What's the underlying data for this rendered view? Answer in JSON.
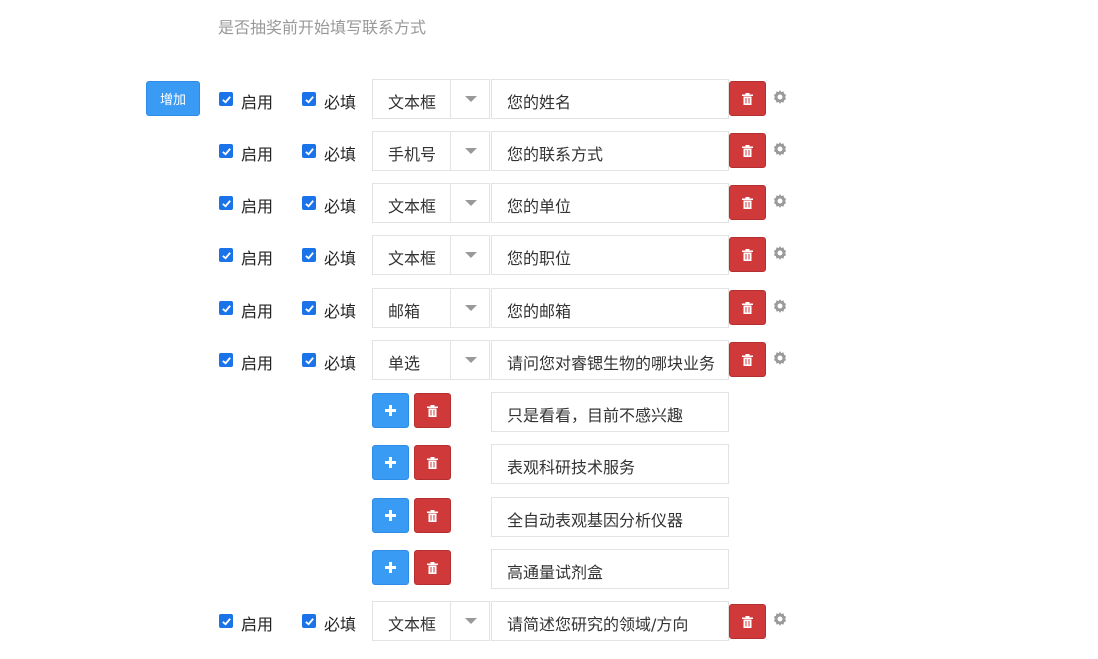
{
  "hint": "是否抽奖前开始填写联系方式",
  "add_label": "增加",
  "enable_label": "启用",
  "required_label": "必填",
  "fields": [
    {
      "type": "文本框",
      "label": "您的姓名"
    },
    {
      "type": "手机号",
      "label": "您的联系方式"
    },
    {
      "type": "文本框",
      "label": "您的单位"
    },
    {
      "type": "文本框",
      "label": "您的职位"
    },
    {
      "type": "邮箱",
      "label": "您的邮箱"
    },
    {
      "type": "单选",
      "label": "请问您对睿锶生物的哪块业务"
    }
  ],
  "options": [
    "只是看看，目前不感兴趣",
    "表观科研技术服务",
    "全自动表观基因分析仪器",
    "高通量试剂盒"
  ],
  "last_field": {
    "type": "文本框",
    "label": "请简述您研究的领域/方向"
  },
  "colors": {
    "primary": "#3a9bf5",
    "danger": "#d0393a",
    "checkbox": "#1a73e8"
  },
  "icons": {
    "delete": "trash-icon",
    "settings": "gear-icon",
    "add": "plus-icon",
    "dropdown": "caret-down-icon"
  }
}
